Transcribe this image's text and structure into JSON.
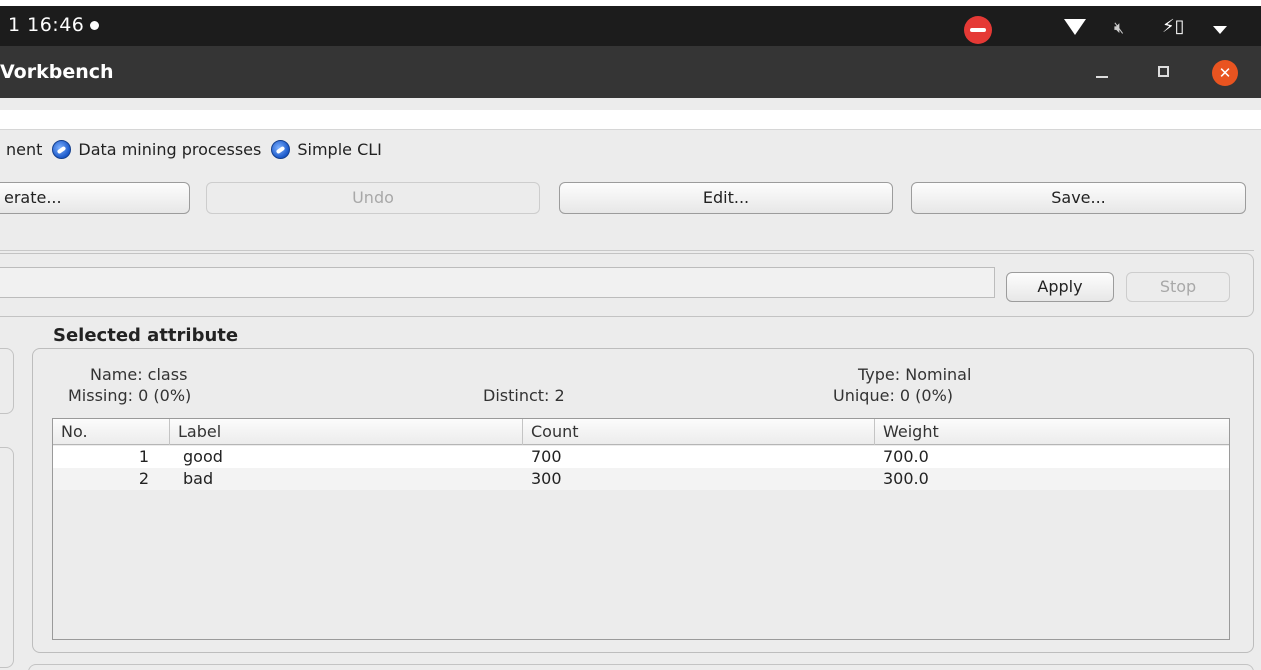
{
  "system_bar": {
    "time": "1 16:46"
  },
  "window": {
    "title": "Vorkbench"
  },
  "tabs": [
    {
      "label": "nent"
    },
    {
      "label": "Data mining processes"
    },
    {
      "label": "Simple CLI"
    }
  ],
  "toolbar": {
    "generate_label": "erate...",
    "undo_label": "Undo",
    "edit_label": "Edit...",
    "save_label": "Save..."
  },
  "filter": {
    "apply_label": "Apply",
    "stop_label": "Stop"
  },
  "selected_attribute": {
    "section_title": "Selected attribute",
    "name": "Name: class",
    "missing": "Missing: 0 (0%)",
    "distinct": "Distinct: 2",
    "type": "Type: Nominal",
    "unique": "Unique: 0 (0%)"
  },
  "table": {
    "columns": [
      "No.",
      "Label",
      "Count",
      "Weight"
    ],
    "rows": [
      {
        "no": "1",
        "label": "good",
        "count": "700",
        "weight": "700.0"
      },
      {
        "no": "2",
        "label": "bad",
        "count": "300",
        "weight": "300.0"
      }
    ]
  }
}
